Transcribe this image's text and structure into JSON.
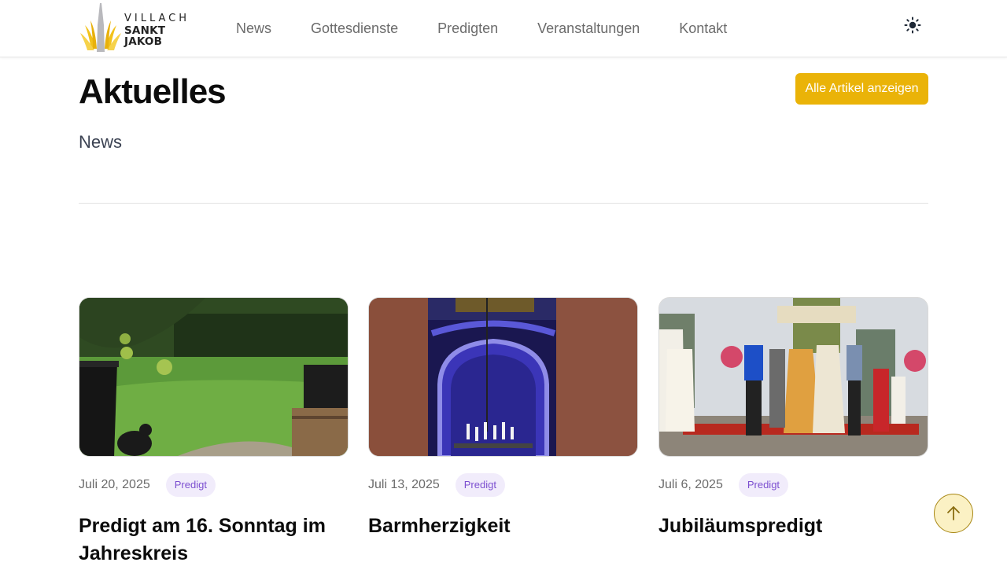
{
  "header": {
    "logo_line1": "VILLACH",
    "logo_line2": "SANKT JAKOB",
    "nav": [
      "News",
      "Gottesdienste",
      "Predigten",
      "Veranstaltungen",
      "Kontakt"
    ],
    "theme_icon": "sun-icon"
  },
  "main": {
    "title": "Aktuelles",
    "subtitle": "News",
    "all_button": "Alle Artikel anzeigen"
  },
  "cards": [
    {
      "date": "Juli 20, 2025",
      "tag": "Predigt",
      "title": "Predigt am 16. Sonntag im Jahreskreis"
    },
    {
      "date": "Juli 13, 2025",
      "tag": "Predigt",
      "title": "Barmherzigkeit"
    },
    {
      "date": "Juli 6, 2025",
      "tag": "Predigt",
      "title": "Jubiläumspredigt"
    }
  ],
  "scroll_top_icon": "arrow-up-icon",
  "colors": {
    "accent": "#eab308",
    "tag_bg": "#f1ecfb",
    "tag_text": "#7c4fd0"
  }
}
